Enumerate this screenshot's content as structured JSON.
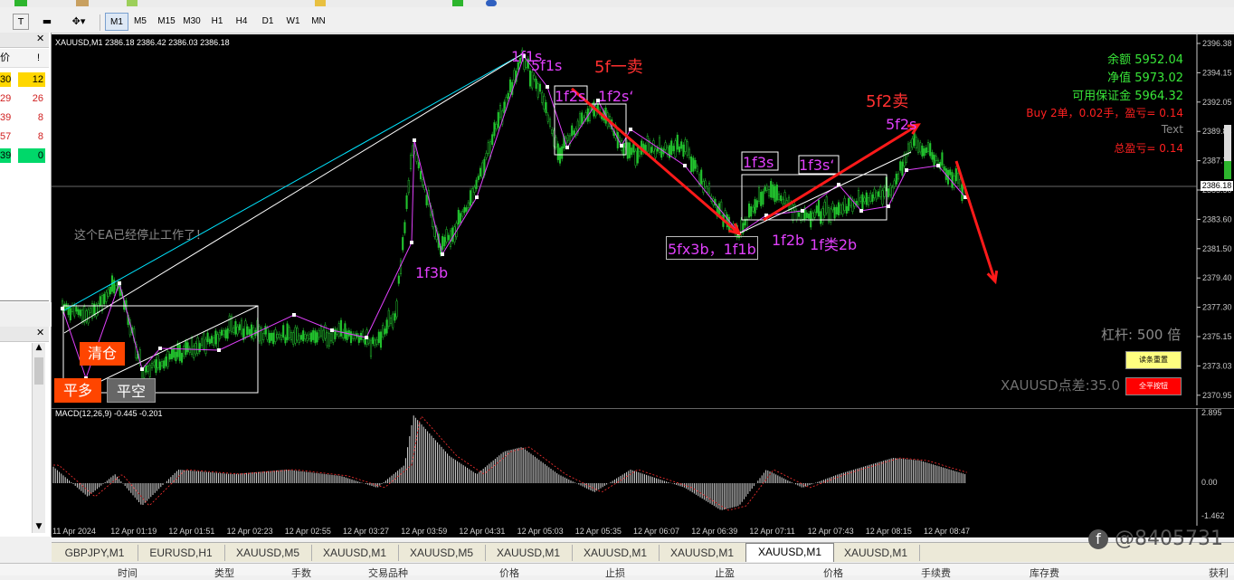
{
  "toolbar": {
    "timeframes": [
      "M1",
      "M5",
      "M15",
      "M30",
      "H1",
      "H4",
      "D1",
      "W1",
      "MN"
    ],
    "selected_timeframe": "M1"
  },
  "market_watch": {
    "headers": [
      "价",
      "!"
    ],
    "rows": [
      {
        "bid": "30",
        "spread": "12",
        "highlight": "#ffd700"
      },
      {
        "bid": "29",
        "spread": "26",
        "highlight": ""
      },
      {
        "bid": "39",
        "spread": "8",
        "highlight": ""
      },
      {
        "bid": "57",
        "spread": "8",
        "highlight": ""
      },
      {
        "bid": "39",
        "spread": "0",
        "highlight": "#00d86a"
      }
    ]
  },
  "chart": {
    "header": "XAUUSD,M1  2386.18 2386.42 2386.03 2386.18",
    "ea_stopped_text": "这个EA已经停止工作了！",
    "current_price_tag": "2386.18",
    "price_ticks": [
      "2396.38",
      "2394.15",
      "2392.05",
      "2389.83",
      "2387.73",
      "2385.50",
      "2383.60",
      "2381.50",
      "2379.40",
      "2377.30",
      "2375.15",
      "2373.03",
      "2370.95"
    ],
    "time_ticks": [
      "11 Apr 2024",
      "12 Apr 01:19",
      "12 Apr 01:51",
      "12 Apr 02:23",
      "12 Apr 02:55",
      "12 Apr 03:27",
      "12 Apr 03:59",
      "12 Apr 04:31",
      "12 Apr 05:03",
      "12 Apr 05:35",
      "12 Apr 06:07",
      "12 Apr 06:39",
      "12 Apr 07:11",
      "12 Apr 07:43",
      "12 Apr 08:15",
      "12 Apr 08:47"
    ],
    "annotations": [
      {
        "text": "1f1s",
        "color": "#e040fb"
      },
      {
        "text": "5f1s",
        "color": "#e040fb"
      },
      {
        "text": "5f一卖",
        "color": "#ff3030"
      },
      {
        "text": "1f2s",
        "color": "#e040fb"
      },
      {
        "text": "1f2s‘",
        "color": "#e040fb"
      },
      {
        "text": "5f2卖",
        "color": "#ff3030"
      },
      {
        "text": "5f2s",
        "color": "#e040fb"
      },
      {
        "text": "1f3s",
        "color": "#e040fb"
      },
      {
        "text": "1f3s‘",
        "color": "#e040fb"
      },
      {
        "text": "1f3b",
        "color": "#e040fb"
      },
      {
        "text": "5fx3b，1f1b",
        "color": "#e040fb"
      },
      {
        "text": "1f2b",
        "color": "#e040fb"
      },
      {
        "text": "1f类2b",
        "color": "#e040fb"
      }
    ],
    "account": {
      "balance": "余额 5952.04",
      "equity": "净值 5973.02",
      "free_margin": "可用保证金 5964.32",
      "positions": "Buy 2单，0.02手，盈亏= 0.14",
      "text_label": "Text",
      "total_pnl": "总盈亏= 0.14",
      "leverage": "杠杆: 500 倍",
      "spread": "XAUUSD点差:35.0"
    },
    "buttons": {
      "clear": "清仓",
      "close_long": "平多",
      "close_short": "平空",
      "yellow_btn": "读条重置",
      "red_btn": "全平按钮"
    },
    "macd": {
      "label": "MACD(12,26,9) -0.445 -0.201",
      "ticks": [
        "2.895",
        "0.00",
        "-1.462"
      ]
    }
  },
  "tabs": [
    "GBPJPY,M1",
    "EURUSD,H1",
    "XAUUSD,M5",
    "XAUUSD,M1",
    "XAUUSD,M5",
    "XAUUSD,M1",
    "XAUUSD,M1",
    "XAUUSD,M1",
    "XAUUSD,M1",
    "XAUUSD,M1"
  ],
  "active_tab": 8,
  "watermark": "@8405731",
  "bottom_headers": [
    "时间",
    "类型",
    "手数",
    "交易品种",
    "价格",
    "止损",
    "止盈",
    "价格",
    "手续费",
    "库存费",
    "获利"
  ],
  "colors": {
    "bull": "#22c32e",
    "bear": "#8fd18f",
    "zigzag": "#e040fb",
    "trend_cyan": "#00e5ff",
    "arrow": "#ff1a1a"
  }
}
